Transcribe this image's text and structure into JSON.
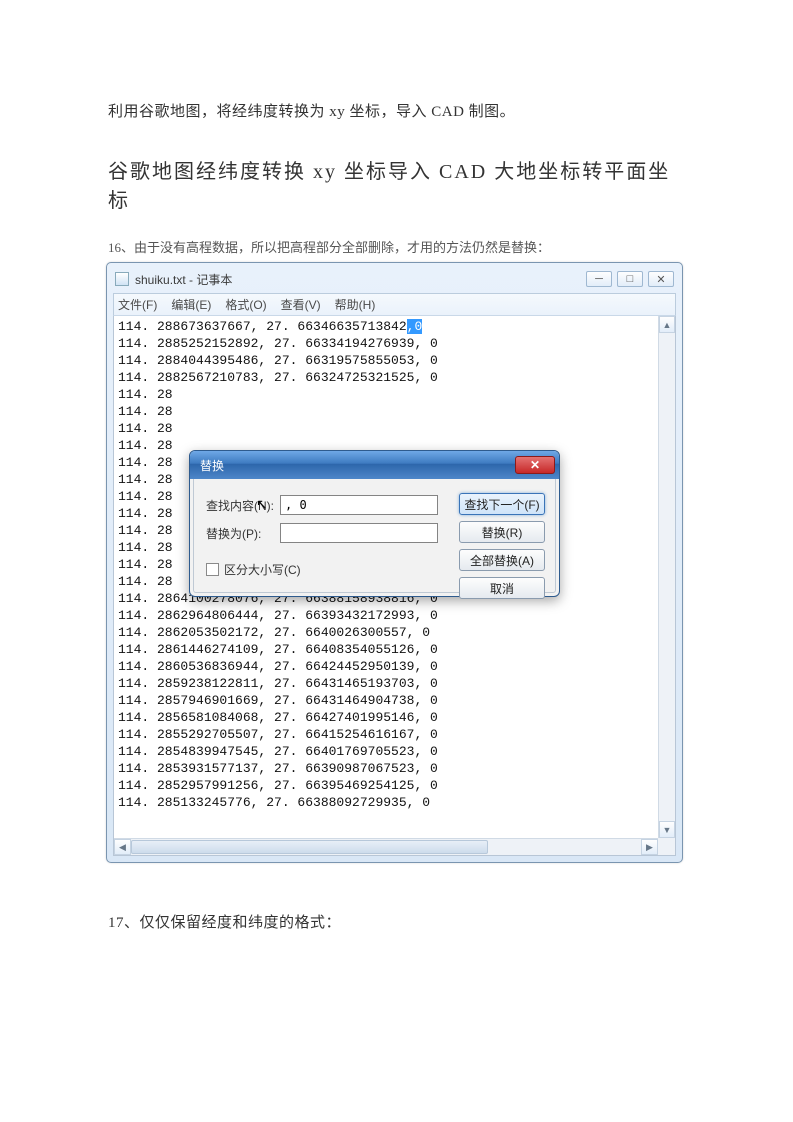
{
  "para1": "利用谷歌地图，将经纬度转换为 xy 坐标，导入 CAD 制图。",
  "heading": "谷歌地图经纬度转换 xy 坐标导入 CAD 大地坐标转平面坐标",
  "step16": "16、由于没有高程数据，所以把高程部分全部删除，才用的方法仍然是替换：",
  "step17": "17、仅仅保留经度和纬度的格式：",
  "notepad": {
    "title": "shuiku.txt - 记事本",
    "menus": [
      "文件(F)",
      "编辑(E)",
      "格式(O)",
      "查看(V)",
      "帮助(H)"
    ],
    "first_line_prefix": "114. 288673637667, 27. 66346635713842",
    "first_line_sel": ",0",
    "lines_group1": [
      "114. 2885252152892, 27. 66334194276939, 0",
      "114. 2884044395486, 27. 66319575855053, 0",
      "114. 2882567210783, 27. 66324725321525, 0"
    ],
    "truncated_prefixes": [
      "114. 28",
      "114. 28",
      "114. 28",
      "114. 28",
      "114. 28",
      "114. 28",
      "114. 28",
      "114. 28",
      "114. 28",
      "114. 28",
      "114. 28",
      "114. 28"
    ],
    "lines_group2": [
      "114. 2864100278076, 27. 66388158938816, 0",
      "114. 2862964806444, 27. 66393432172993, 0",
      "114. 2862053502172, 27. 6640026300557, 0",
      "114. 2861446274109, 27. 66408354055126, 0",
      "114. 2860536836944, 27. 66424452950139, 0",
      "114. 2859238122811, 27. 66431465193703, 0",
      "114. 2857946901669, 27. 66431464904738, 0",
      "114. 2856581084068, 27. 66427401995146, 0",
      "114. 2855292705507, 27. 66415254616167, 0",
      "114. 2854839947545, 27. 66401769705523, 0",
      "114. 2853931577137, 27. 66390987067523, 0",
      "114. 2852957991256, 27. 66395469254125, 0",
      "114. 285133245776, 27. 66388092729935, 0"
    ]
  },
  "dialog": {
    "title": "替换",
    "find_label": "查找内容(N):",
    "find_value": ", 0",
    "replace_label": "替换为(P):",
    "replace_value": "",
    "case_label": "区分大小写(C)",
    "buttons": {
      "find_next": "查找下一个(F)",
      "replace": "替换(R)",
      "replace_all": "全部替换(A)",
      "cancel": "取消"
    }
  }
}
